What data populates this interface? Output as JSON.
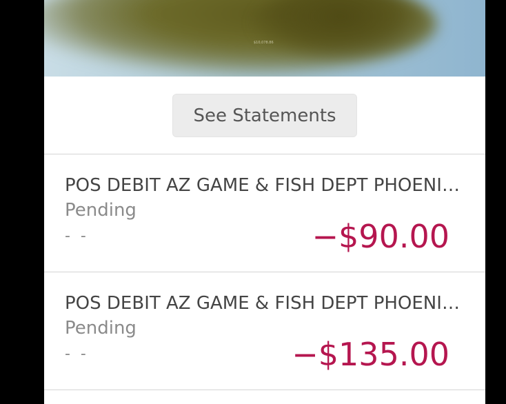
{
  "hero": {
    "small_text": "$10,078.86"
  },
  "statements": {
    "button_label": "See Statements"
  },
  "transactions": [
    {
      "description": "POS DEBIT AZ GAME & FISH DEPT PHOENIX AZ",
      "status": "Pending",
      "secondary": "- -",
      "amount": "−$90.00"
    },
    {
      "description": "POS DEBIT AZ GAME & FISH DEPT PHOENIX AZ",
      "status": "Pending",
      "secondary": "- -",
      "amount": "−$135.00"
    }
  ],
  "colors": {
    "amount": "#b5164f",
    "background": "#ffffff",
    "button": "#ececec"
  }
}
